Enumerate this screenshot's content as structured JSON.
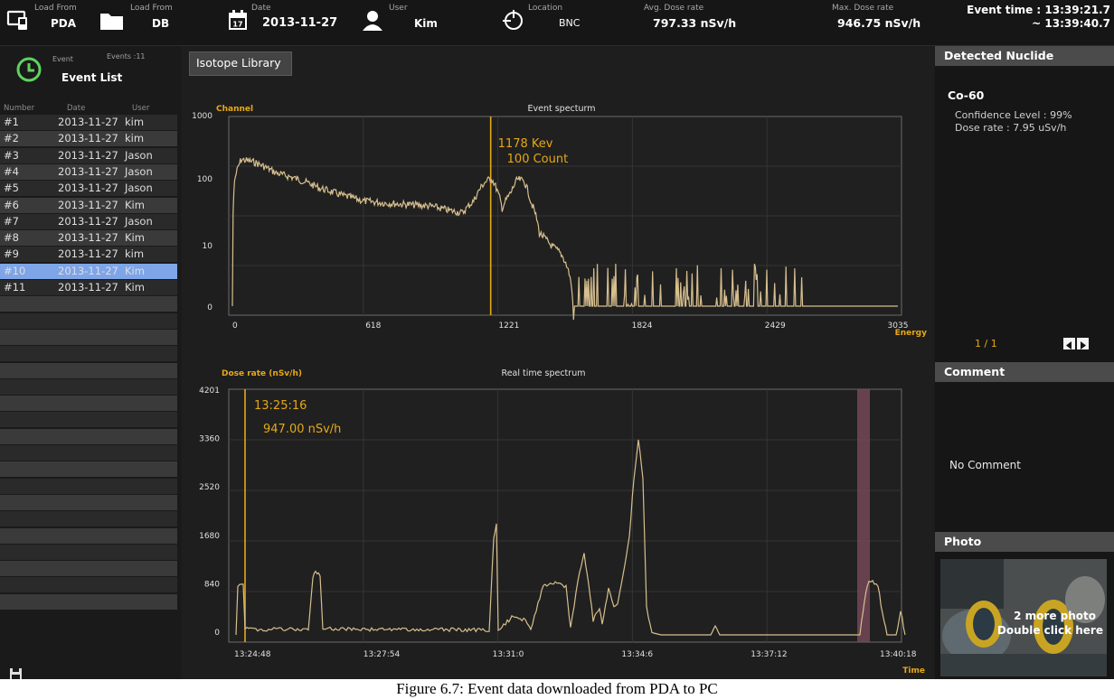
{
  "topbar": {
    "load_pda": {
      "label": "Load From",
      "value": "PDA"
    },
    "load_db": {
      "label": "Load From",
      "value": "DB"
    },
    "date": {
      "label": "Date",
      "value": "2013-11-27",
      "icon_day": "17"
    },
    "user": {
      "label": "User",
      "value": "Kim"
    },
    "location": {
      "label": "Location",
      "value": "BNC"
    },
    "avg_dose": {
      "label": "Avg. Dose rate",
      "value": "797.33 nSv/h"
    },
    "max_dose": {
      "label": "Max. Dose rate",
      "value": "946.75 nSv/h"
    },
    "event_time": {
      "line1": "Event time : 13:39:21.7",
      "line2": "~ 13:39:40.7"
    }
  },
  "sidebar": {
    "event_label": "Event",
    "events_count": "Events :11",
    "title": "Event List",
    "columns": [
      "Number",
      "Date",
      "User"
    ],
    "rows": [
      {
        "num": "#1",
        "date": "2013-11-27",
        "user": "kim"
      },
      {
        "num": "#2",
        "date": "2013-11-27",
        "user": "kim"
      },
      {
        "num": "#3",
        "date": "2013-11-27",
        "user": "Jason"
      },
      {
        "num": "#4",
        "date": "2013-11-27",
        "user": "Jason"
      },
      {
        "num": "#5",
        "date": "2013-11-27",
        "user": "Jason"
      },
      {
        "num": "#6",
        "date": "2013-11-27",
        "user": "Kim"
      },
      {
        "num": "#7",
        "date": "2013-11-27",
        "user": "Jason"
      },
      {
        "num": "#8",
        "date": "2013-11-27",
        "user": "Kim"
      },
      {
        "num": "#9",
        "date": "2013-11-27",
        "user": "kim"
      },
      {
        "num": "#10",
        "date": "2013-11-27",
        "user": "Kim"
      },
      {
        "num": "#11",
        "date": "2013-11-27",
        "user": "Kim"
      }
    ],
    "selected_index": 9
  },
  "center": {
    "isotope_button": "Isotope Library"
  },
  "chart_data": [
    {
      "type": "line",
      "title": "Event specturm",
      "ylabel": "Channel",
      "xlabel": "Energy",
      "yscale": "log",
      "yticks": [
        "1000",
        "100",
        "10",
        "0"
      ],
      "xticks": [
        "0",
        "618",
        "1221",
        "1824",
        "2429",
        "3035"
      ],
      "xlim": [
        0,
        3035
      ],
      "marker": {
        "x": 1178,
        "label1": "1178 Kev",
        "label2": "100 Count"
      },
      "points": [
        [
          0,
          0
        ],
        [
          10,
          90
        ],
        [
          40,
          200
        ],
        [
          100,
          180
        ],
        [
          200,
          120
        ],
        [
          300,
          95
        ],
        [
          400,
          70
        ],
        [
          500,
          55
        ],
        [
          600,
          45
        ],
        [
          700,
          42
        ],
        [
          800,
          40
        ],
        [
          900,
          38
        ],
        [
          1000,
          32
        ],
        [
          1050,
          30
        ],
        [
          1100,
          45
        ],
        [
          1150,
          85
        ],
        [
          1180,
          100
        ],
        [
          1200,
          75
        ],
        [
          1230,
          35
        ],
        [
          1270,
          60
        ],
        [
          1300,
          95
        ],
        [
          1330,
          90
        ],
        [
          1360,
          45
        ],
        [
          1400,
          15
        ],
        [
          1450,
          10
        ],
        [
          1500,
          7
        ],
        [
          1540,
          3
        ],
        [
          1560,
          0
        ],
        [
          2429,
          0
        ],
        [
          3035,
          0
        ]
      ],
      "color": "#d7bf8e"
    },
    {
      "type": "line",
      "title": "Real time spectrum",
      "ylabel": "Dose rate (nSv/h)",
      "xlabel": "Time",
      "yticks": [
        "4201",
        "3360",
        "2520",
        "1680",
        "840",
        "0"
      ],
      "ylim": [
        0,
        4201
      ],
      "xticks": [
        "13:24:48",
        "13:27:54",
        "13:31:0",
        "13:34:6",
        "13:37:12",
        "13:40:18"
      ],
      "marker": {
        "label1": "13:25:16",
        "label2": "947.00 nSv/h"
      },
      "points": [
        [
          0,
          0
        ],
        [
          2,
          870
        ],
        [
          8,
          900
        ],
        [
          10,
          120
        ],
        [
          20,
          95
        ],
        [
          60,
          95
        ],
        [
          80,
          90
        ],
        [
          85,
          1000
        ],
        [
          88,
          1100
        ],
        [
          93,
          1050
        ],
        [
          96,
          110
        ],
        [
          150,
          95
        ],
        [
          240,
          90
        ],
        [
          275,
          85
        ],
        [
          280,
          60
        ],
        [
          285,
          1650
        ],
        [
          288,
          1900
        ],
        [
          290,
          100
        ],
        [
          300,
          230
        ],
        [
          305,
          300
        ],
        [
          320,
          260
        ],
        [
          326,
          110
        ],
        [
          340,
          850
        ],
        [
          355,
          900
        ],
        [
          365,
          840
        ],
        [
          370,
          120
        ],
        [
          380,
          1100
        ],
        [
          385,
          1400
        ],
        [
          390,
          900
        ],
        [
          395,
          250
        ],
        [
          402,
          480
        ],
        [
          405,
          210
        ],
        [
          412,
          800
        ],
        [
          418,
          500
        ],
        [
          422,
          520
        ],
        [
          428,
          1050
        ],
        [
          435,
          1700
        ],
        [
          440,
          2700
        ],
        [
          445,
          3400
        ],
        [
          450,
          2700
        ],
        [
          454,
          500
        ],
        [
          458,
          150
        ],
        [
          460,
          40
        ],
        [
          470,
          0
        ],
        [
          525,
          0
        ],
        [
          530,
          150
        ],
        [
          535,
          0
        ],
        [
          690,
          0
        ],
        [
          695,
          600
        ],
        [
          700,
          950
        ],
        [
          710,
          870
        ],
        [
          715,
          350
        ],
        [
          720,
          0
        ],
        [
          730,
          0
        ],
        [
          735,
          420
        ],
        [
          740,
          0
        ]
      ],
      "color": "#d7bf8e"
    }
  ],
  "right": {
    "detected_title": "Detected Nuclide",
    "nuclide": "Co-60",
    "confidence": "Confidence Level : 99%",
    "dose_rate": "Dose rate : 7.95 uSv/h",
    "page": "1 / 1",
    "comment_title": "Comment",
    "comment_text": "No Comment",
    "photo_title": "Photo",
    "photo_line1": "2 more photo",
    "photo_line2": "Double click here"
  },
  "caption": "Figure 6.7: Event data downloaded from PDA to PC"
}
